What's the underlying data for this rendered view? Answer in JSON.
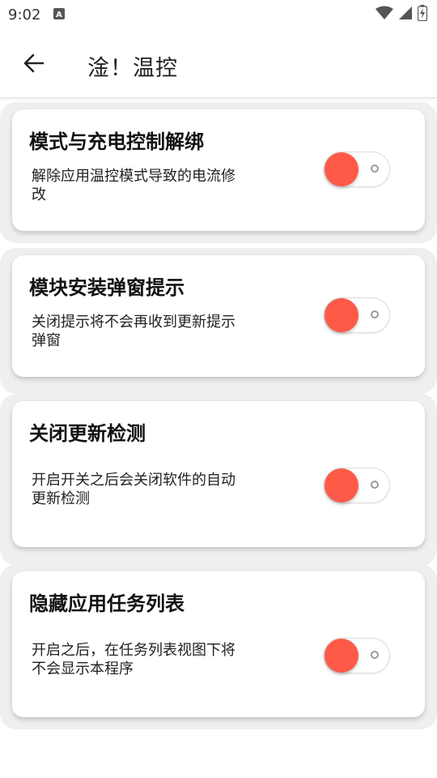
{
  "status_bar": {
    "time": "9:02",
    "notification_icon": "a-letter-icon"
  },
  "app_bar": {
    "title": "淦！温控",
    "back_icon": "arrow-back-icon"
  },
  "accent_color": "#ff5a47",
  "settings": [
    {
      "title": "模式与充电控制解绑",
      "description_line1": "解除应用温控模式导致的电流修",
      "description_line2": "改",
      "toggle_on": true
    },
    {
      "title": "模块安装弹窗提示",
      "description_line1": "关闭提示将不会再收到更新提示",
      "description_line2": "弹窗",
      "toggle_on": true
    },
    {
      "title": "关闭更新检测",
      "description_line1": "开启开关之后会关闭软件的自动",
      "description_line2": "更新检测",
      "toggle_on": true
    },
    {
      "title": "隐藏应用任务列表",
      "description_line1": "开启之后，在任务列表视图下将",
      "description_line2": "不会显示本程序",
      "toggle_on": true
    }
  ]
}
